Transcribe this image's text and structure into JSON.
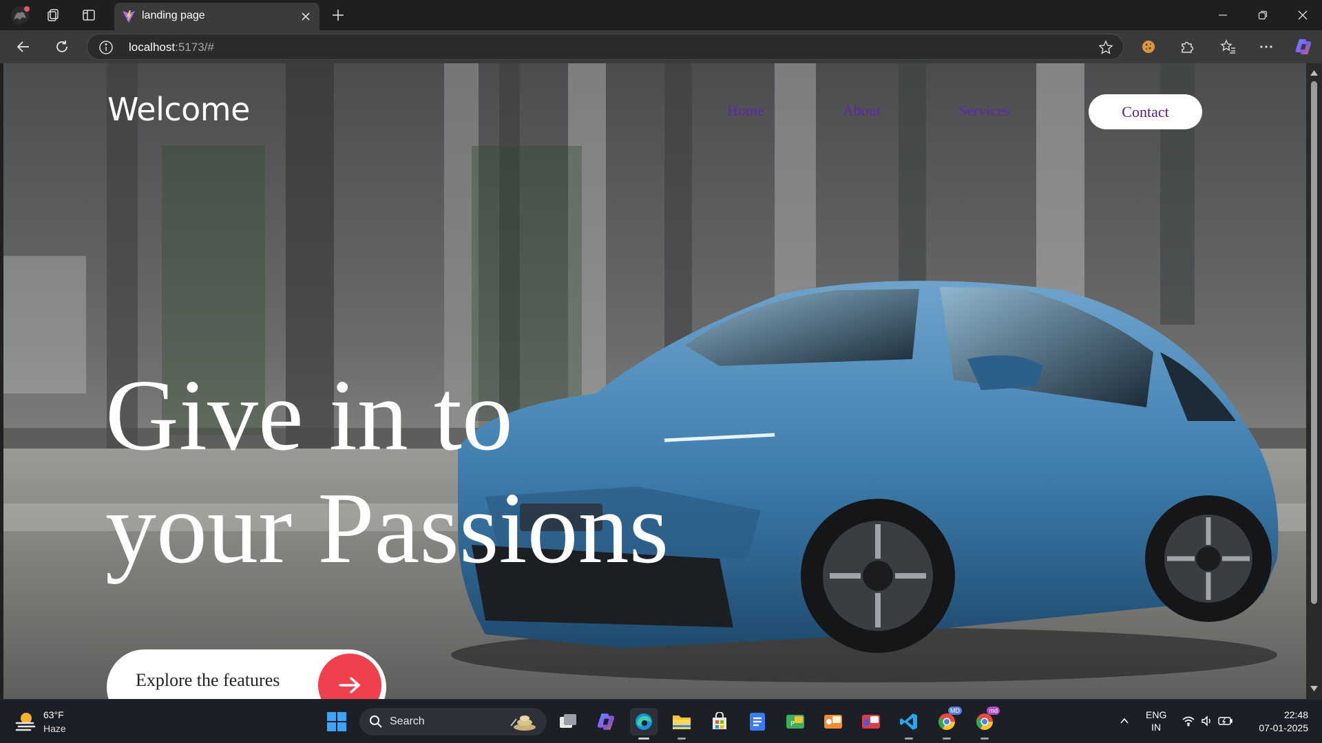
{
  "browser": {
    "tab_title": "landing page",
    "url_host": "localhost",
    "url_rest": ":5173/#",
    "accent": "#3b3b3b"
  },
  "page": {
    "brand": "Welcome",
    "nav": [
      {
        "label": "Home"
      },
      {
        "label": "About"
      },
      {
        "label": "Services"
      }
    ],
    "contact_label": "Contact",
    "headline_line1": "Give in to",
    "headline_line2": "your Passions",
    "cta_label": "Explore the features",
    "colors": {
      "nav_link": "#5b2aa8",
      "cta_arrow_bg": "#f0404e",
      "car_body": "#3f7fb0"
    }
  },
  "taskbar": {
    "weather_temp": "63°F",
    "weather_desc": "Haze",
    "search_label": "Search",
    "lang_line1": "ENG",
    "lang_line2": "IN",
    "time": "22:48",
    "date": "07-01-2025",
    "chrome_badge_1": "MD",
    "chrome_badge_2": "md"
  }
}
